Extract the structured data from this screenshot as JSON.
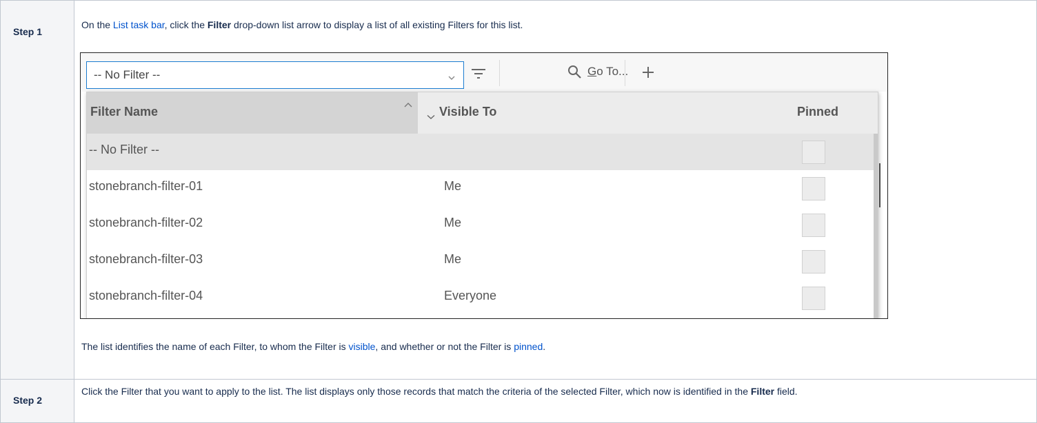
{
  "step1": {
    "label": "Step 1",
    "intro_prefix": "On the ",
    "intro_link": "List task bar",
    "intro_mid": ", click the ",
    "intro_bold": "Filter",
    "intro_suffix": " drop-down list arrow to display a list of all existing Filters for this list.",
    "outro_prefix": "The list identifies the name of each Filter, to whom the Filter is ",
    "outro_link1": "visible",
    "outro_mid": ", and whether or not the Filter is ",
    "outro_link2": "pinned",
    "outro_suffix": "."
  },
  "step2": {
    "label": "Step 2",
    "text_prefix": "Click the Filter that you want to apply to the list. The list displays only those records that match the criteria of the selected Filter, which now is identified in the ",
    "text_bold": "Filter",
    "text_suffix": " field."
  },
  "screenshot": {
    "filter_value": "-- No Filter --",
    "goto_underlined": "G",
    "goto_rest": "o To...",
    "columns": {
      "name": "Filter Name",
      "visible_to": "Visible To",
      "pinned": "Pinned"
    },
    "rows": [
      {
        "name": "-- No Filter --",
        "visible_to": "",
        "selected": true
      },
      {
        "name": "stonebranch-filter-01",
        "visible_to": "Me",
        "selected": false
      },
      {
        "name": "stonebranch-filter-02",
        "visible_to": "Me",
        "selected": false
      },
      {
        "name": "stonebranch-filter-03",
        "visible_to": "Me",
        "selected": false
      },
      {
        "name": "stonebranch-filter-04",
        "visible_to": "Everyone",
        "selected": false
      }
    ],
    "icons": [
      "chevron-down-icon",
      "filter-lines-icon",
      "search-icon",
      "plus-icon",
      "sort-up-icon",
      "chevron-down-icon"
    ]
  },
  "colors": {
    "link": "#0052cc",
    "text": "#172b4d",
    "select_border": "#1a7bd0",
    "selected_row": "#e4e4e4"
  }
}
